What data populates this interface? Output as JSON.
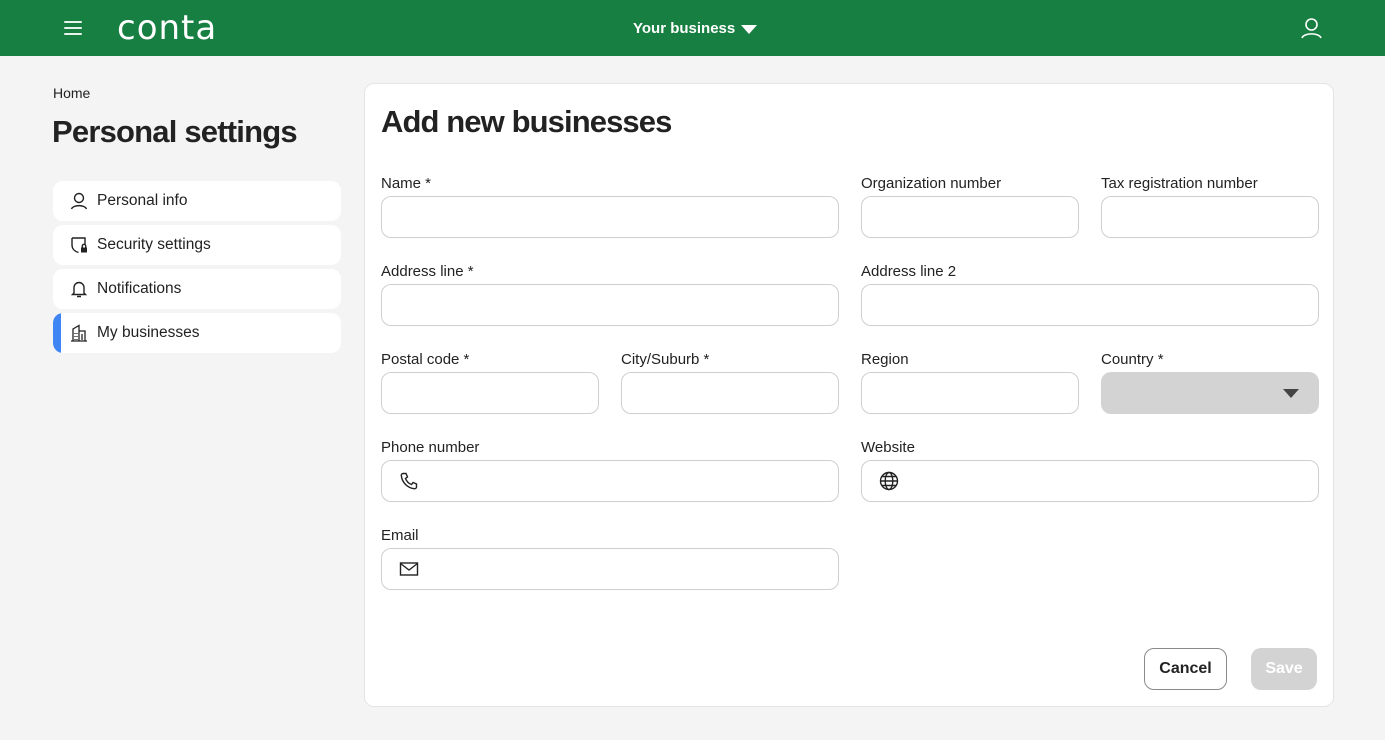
{
  "topbar": {
    "logo_text": "conta",
    "business_switcher_label": "Your business",
    "bg_color": "#177f41"
  },
  "breadcrumb": {
    "home": "Home"
  },
  "page_title": "Personal settings",
  "sidebar": {
    "items": [
      {
        "label": "Personal info",
        "icon": "user-icon",
        "active": false
      },
      {
        "label": "Security settings",
        "icon": "shield-lock-icon",
        "active": false
      },
      {
        "label": "Notifications",
        "icon": "bell-icon",
        "active": false
      },
      {
        "label": "My businesses",
        "icon": "building-icon",
        "active": true
      }
    ],
    "active_color": "#3f86f4"
  },
  "form": {
    "title": "Add new businesses",
    "fields": {
      "name": {
        "label": "Name *",
        "value": ""
      },
      "org_number": {
        "label": "Organization number",
        "value": ""
      },
      "tax_number": {
        "label": "Tax registration number",
        "value": ""
      },
      "address1": {
        "label": "Address line *",
        "value": ""
      },
      "address2": {
        "label": "Address line 2",
        "value": ""
      },
      "postal_code": {
        "label": "Postal code *",
        "value": ""
      },
      "city": {
        "label": "City/Suburb *",
        "value": ""
      },
      "region": {
        "label": "Region",
        "value": ""
      },
      "country": {
        "label": "Country *",
        "selected": ""
      },
      "phone": {
        "label": "Phone number",
        "value": "",
        "icon": "phone-icon"
      },
      "website": {
        "label": "Website",
        "value": "",
        "icon": "globe-icon"
      },
      "email": {
        "label": "Email",
        "value": "",
        "icon": "mail-icon"
      }
    },
    "buttons": {
      "cancel": "Cancel",
      "save": "Save"
    }
  }
}
